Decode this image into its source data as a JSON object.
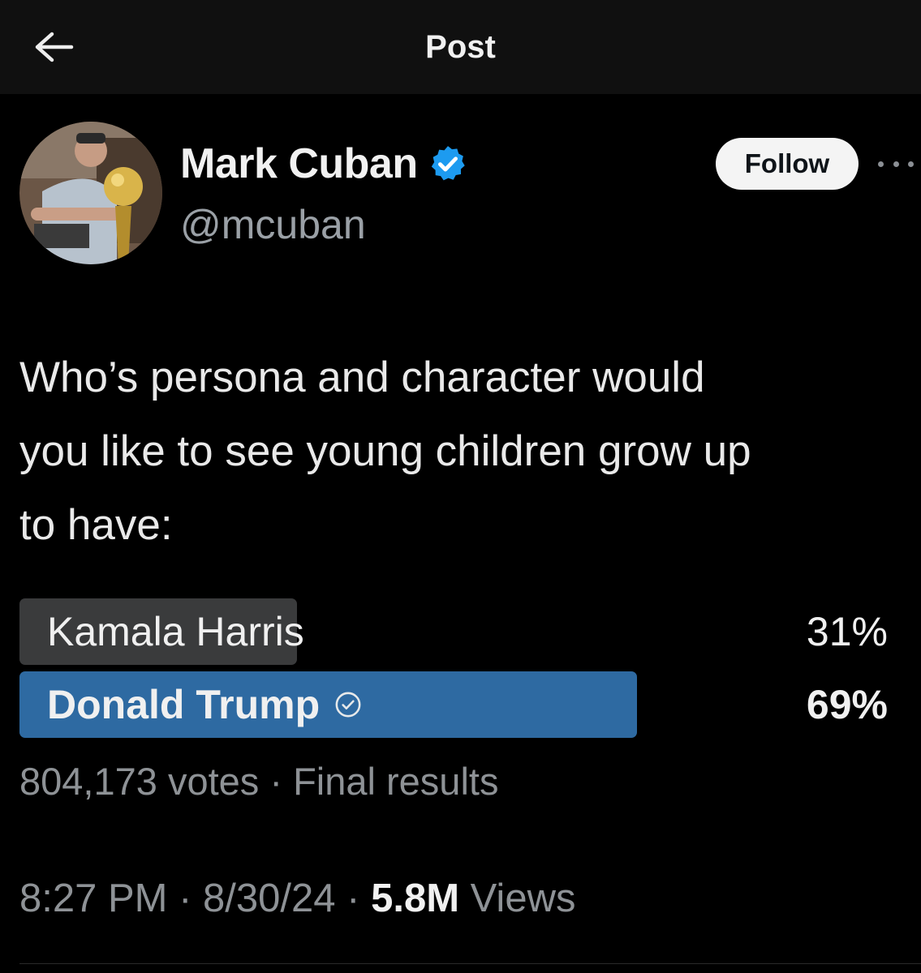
{
  "header": {
    "title": "Post",
    "back_icon": "arrow-left-icon"
  },
  "author": {
    "name": "Mark Cuban",
    "handle": "@mcuban",
    "verified": true,
    "verified_color": "#1d9bf0"
  },
  "actions": {
    "follow_label": "Follow",
    "more_icon": "ellipsis-icon"
  },
  "post": {
    "text_lines": [
      "Who’s persona and character would",
      "you like to see young children grow up",
      "to have:"
    ]
  },
  "poll": {
    "options": [
      {
        "label": "Kamala Harris",
        "percent_label": "31%",
        "percent": 31,
        "winner": false,
        "bar_color": "#3a3b3c"
      },
      {
        "label": "Donald Trump",
        "percent_label": "69%",
        "percent": 69,
        "winner": true,
        "bar_color": "#2e6aa2"
      }
    ],
    "votes": "804,173 votes",
    "separator": " · ",
    "status": "Final results"
  },
  "meta": {
    "time": "8:27 PM",
    "date": "8/30/24",
    "separator": " · ",
    "views_count": "5.8M",
    "views_label": " Views"
  }
}
